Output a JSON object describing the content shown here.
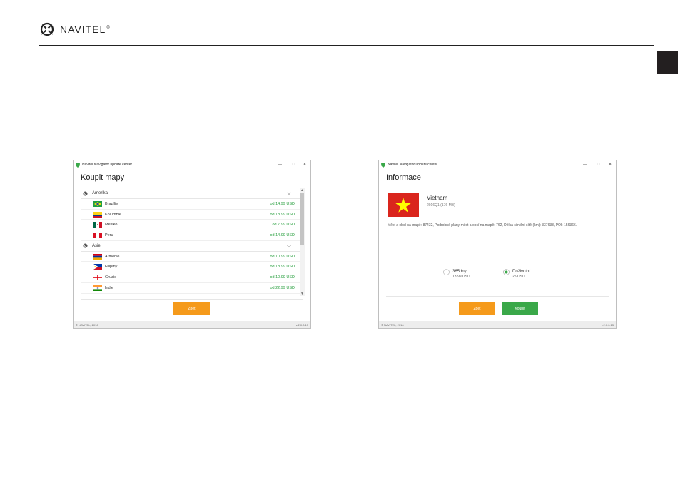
{
  "brand": {
    "name": "NAVITEL",
    "reg_mark": "®"
  },
  "window_buy": {
    "title": "Navitel Navigator update center",
    "heading": "Koupit mapy",
    "groups": [
      {
        "name": "Amerika",
        "items": [
          {
            "name": "Brazílie",
            "price": "od 14.99 USD"
          },
          {
            "name": "Kolumbie",
            "price": "od 18.99 USD"
          },
          {
            "name": "Mexiko",
            "price": "od 7.99 USD"
          },
          {
            "name": "Peru",
            "price": "od 14.99 USD"
          }
        ]
      },
      {
        "name": "Asie",
        "items": [
          {
            "name": "Arménie",
            "price": "od 10.99 USD"
          },
          {
            "name": "Filipíny",
            "price": "od 18.99 USD"
          },
          {
            "name": "Gruzie",
            "price": "od 10.99 USD"
          },
          {
            "name": "Indie",
            "price": "od 22.99 USD"
          }
        ]
      }
    ],
    "back_button": "Zpět",
    "footer_left": "© NAVITEL, 2016",
    "footer_right": "v.2.0.0.13"
  },
  "window_info": {
    "title": "Navitel Navigator update center",
    "heading": "Informace",
    "country": "Vietnam",
    "version": "2016Q1 (176 MB)",
    "description": "Měst a obcí na mapě: 87432, Podrobné plány měst a obcí na mapě: 762, Délka silniční sítě (km): 337638, POI: 156366.",
    "options": [
      {
        "label": "365dny",
        "price": "18.99 USD",
        "selected": false
      },
      {
        "label": "Doživotní",
        "price": "25 USD",
        "selected": true
      }
    ],
    "back_button": "Zpět",
    "buy_button": "Koupit",
    "footer_left": "© NAVITEL, 2016",
    "footer_right": "v.2.0.0.13"
  },
  "colors": {
    "accent_orange": "#f59a1b",
    "accent_green": "#3aa849",
    "price_green": "#2aa040"
  }
}
